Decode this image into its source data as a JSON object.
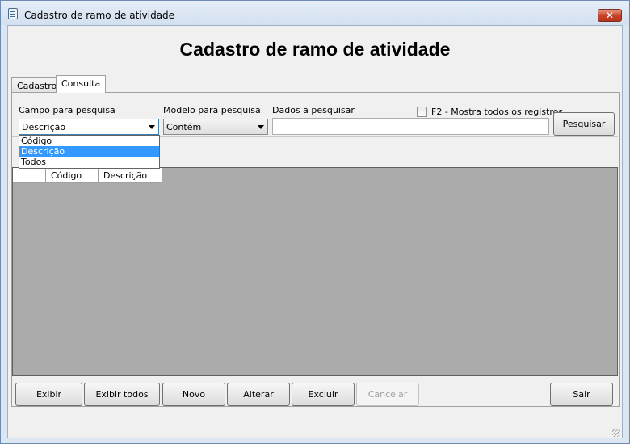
{
  "window": {
    "title": "Cadastro de ramo de atividade",
    "close_label": "✕"
  },
  "heading": "Cadastro de ramo de atividade",
  "tabs": [
    {
      "label": "Cadastro"
    },
    {
      "label": "Consulta"
    }
  ],
  "search": {
    "field_label": "Campo para pesquisa",
    "field_value": "Descrição",
    "field_options": [
      "Código",
      "Descrição",
      "Todos"
    ],
    "model_label": "Modelo para pesquisa",
    "model_value": "Contém",
    "data_label": "Dados a pesquisar",
    "data_value": "",
    "show_all_label": "F2 - Mostra todos os registros",
    "search_button": "Pesquisar"
  },
  "grid": {
    "columns": [
      "",
      "Código",
      "Descrição"
    ]
  },
  "buttons": {
    "exibir": "Exibir",
    "exibir_todos": "Exibir todos",
    "novo": "Novo",
    "alterar": "Alterar",
    "excluir": "Excluir",
    "cancelar": "Cancelar",
    "sair": "Sair"
  },
  "colors": {
    "selection": "#3399ff",
    "grid_background": "#ababab",
    "window_frame": "#dce6f2"
  }
}
